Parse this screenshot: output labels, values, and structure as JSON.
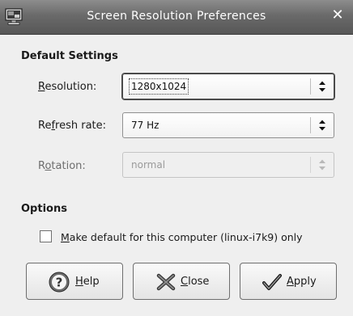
{
  "window": {
    "title": "Screen Resolution Preferences",
    "icon": "display-preferences-icon",
    "close_icon": "close-icon"
  },
  "default_settings": {
    "heading": "Default Settings",
    "resolution": {
      "label_pre": "",
      "label_key": "R",
      "label_post": "esolution:",
      "value": "1280x1024"
    },
    "refresh_rate": {
      "label_pre": "Re",
      "label_key": "f",
      "label_post": "resh rate:",
      "value": "77 Hz"
    },
    "rotation": {
      "label_pre": "R",
      "label_key": "o",
      "label_post": "tation:",
      "value": "normal",
      "disabled": true
    }
  },
  "options": {
    "heading": "Options",
    "make_default": {
      "label_key": "M",
      "label_rest": "ake default for this computer (linux-i7k9) only",
      "checked": false
    }
  },
  "buttons": {
    "help": {
      "label_key": "H",
      "label_rest": "elp",
      "icon": "help-icon"
    },
    "close": {
      "label_key": "C",
      "label_rest": "lose",
      "icon": "close-icon"
    },
    "apply": {
      "label_key": "A",
      "label_rest": "pply",
      "icon": "checkmark-icon"
    }
  },
  "colors": {
    "titlebar": "#6a6a6a",
    "dialog_bg": "#efefef",
    "disabled_text": "#9a9a9a"
  }
}
